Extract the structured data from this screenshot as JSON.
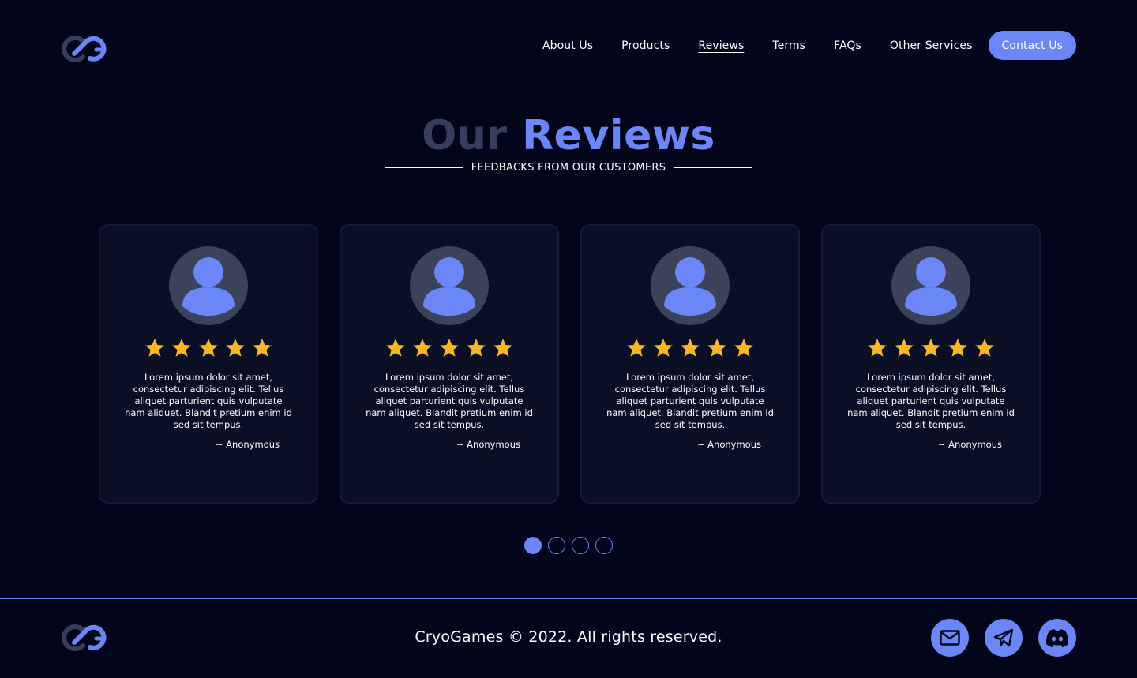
{
  "nav": {
    "items": [
      {
        "label": "About Us"
      },
      {
        "label": "Products"
      },
      {
        "label": "Reviews",
        "active": true
      },
      {
        "label": "Terms"
      },
      {
        "label": "FAQs"
      },
      {
        "label": "Other Services"
      }
    ],
    "contact_label": "Contact Us"
  },
  "logo": {
    "icon": "cryogames-logo"
  },
  "section": {
    "title_part1": "Our",
    "title_part2": "Reviews",
    "subtitle": "FEEDBACKS FROM OUR CUSTOMERS"
  },
  "reviews": [
    {
      "stars": 5,
      "text": "Lorem ipsum dolor sit amet, consectetur adipiscing elit. Tellus aliquet parturient quis vulputate nam aliquet. Blandit pretium enim id sed sit tempus.",
      "author": "~ Anonymous"
    },
    {
      "stars": 5,
      "text": "Lorem ipsum dolor sit amet, consectetur adipiscing elit. Tellus aliquet parturient quis vulputate nam aliquet. Blandit pretium enim id sed sit tempus.",
      "author": "~ Anonymous"
    },
    {
      "stars": 5,
      "text": "Lorem ipsum dolor sit amet, consectetur adipiscing elit. Tellus aliquet parturient quis vulputate nam aliquet. Blandit pretium enim id sed sit tempus.",
      "author": "~ Anonymous"
    },
    {
      "stars": 5,
      "text": "Lorem ipsum dolor sit amet, consectetur adipiscing elit. Tellus aliquet parturient quis vulputate nam aliquet. Blandit pretium enim id sed sit tempus.",
      "author": "~ Anonymous"
    }
  ],
  "pagination": {
    "pages": 4,
    "active": 1
  },
  "footer": {
    "copyright": "CryoGames © 2022. All rights reserved.",
    "socials": [
      {
        "icon": "mail-icon"
      },
      {
        "icon": "telegram-icon"
      },
      {
        "icon": "discord-icon"
      }
    ]
  },
  "colors": {
    "background": "#03061a",
    "accent": "#6b86f6",
    "muted_title": "#363d5d",
    "card_bg": "#0a0f26",
    "star": "#fbb622"
  }
}
